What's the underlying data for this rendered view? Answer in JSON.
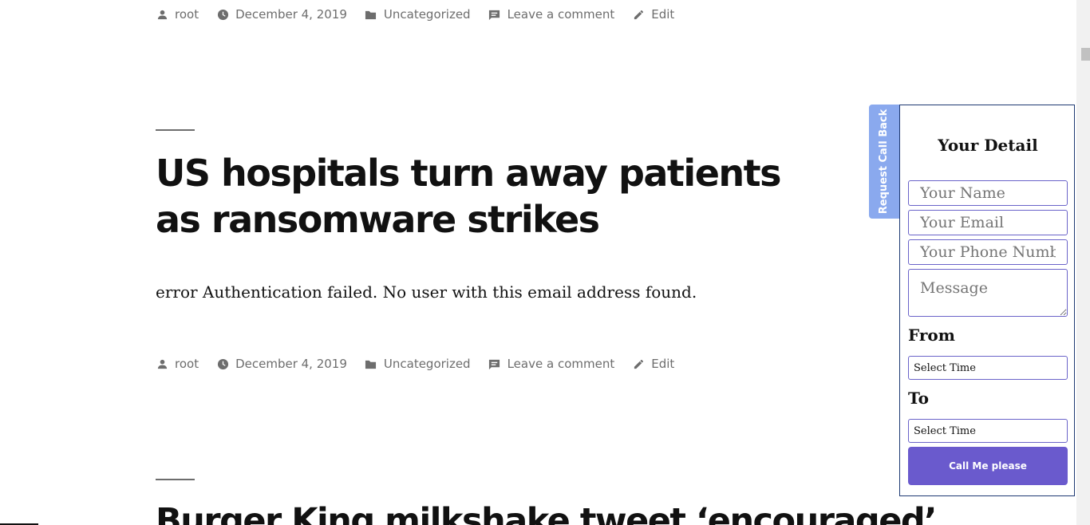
{
  "post_meta_top": {
    "author": "root",
    "date": "December 4, 2019",
    "category": "Uncategorized",
    "comment_link": "Leave a comment",
    "edit_link": "Edit"
  },
  "post": {
    "title": "US hospitals turn away patients as ransomware strikes",
    "content": "error Authentication failed. No user with this email address found."
  },
  "post_meta": {
    "author": "root",
    "date": "December 4, 2019",
    "category": "Uncategorized",
    "comment_link": "Leave a comment",
    "edit_link": "Edit"
  },
  "next_post": {
    "title": "Burger King milkshake tweet ‘encouraged’"
  },
  "callback_widget": {
    "tab_label": "Request Call Back",
    "heading": "Your Detail",
    "name_placeholder": "Your Name",
    "email_placeholder": "Your Email",
    "phone_placeholder": "Your Phone Number",
    "message_placeholder": "Message",
    "from_label": "From",
    "from_value": "Select Time",
    "to_label": "To",
    "to_value": "Select Time",
    "submit_label": "Call Me please"
  },
  "colors": {
    "meta_text": "#6d6d6d",
    "tab_background": "#8aa9ee",
    "button_background": "#6a5acd",
    "field_border": "#6a63c9"
  },
  "icons": {
    "author": "person-icon",
    "date": "clock-icon",
    "category": "folder-icon",
    "comment": "comment-icon",
    "edit": "pencil-icon"
  }
}
